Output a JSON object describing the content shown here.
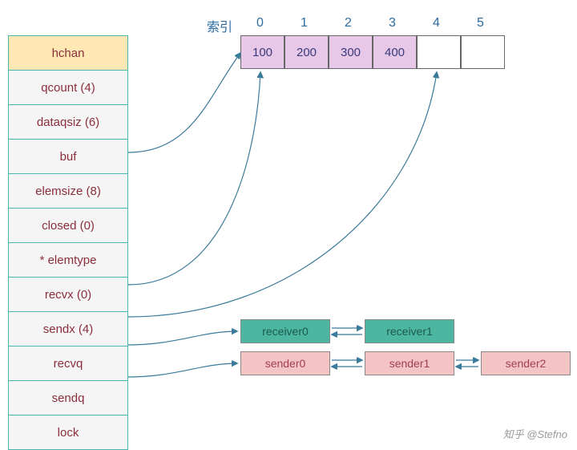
{
  "index_title": "索引",
  "indices": [
    "0",
    "1",
    "2",
    "3",
    "4",
    "5"
  ],
  "struct": {
    "header": "hchan",
    "rows": [
      "qcount (4)",
      "dataqsiz (6)",
      "buf",
      "elemsize (8)",
      "closed (0)",
      "* elemtype",
      "recvx (0)",
      "sendx (4)",
      "recvq",
      "sendq",
      "lock"
    ]
  },
  "buffer": {
    "cells": [
      {
        "value": "100",
        "filled": true
      },
      {
        "value": "200",
        "filled": true
      },
      {
        "value": "300",
        "filled": true
      },
      {
        "value": "400",
        "filled": true
      },
      {
        "value": "",
        "filled": false
      },
      {
        "value": "",
        "filled": false
      }
    ]
  },
  "receivers": [
    "receiver0",
    "receiver1"
  ],
  "senders": [
    "sender0",
    "sender1",
    "sender2"
  ],
  "watermark": "知乎 @Stefno"
}
